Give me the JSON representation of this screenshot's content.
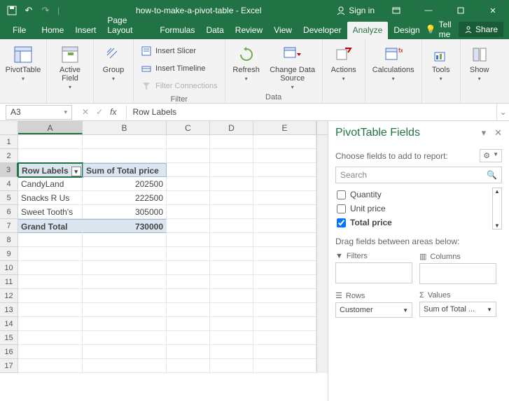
{
  "titlebar": {
    "title": "how-to-make-a-pivot-table - Excel",
    "signin": "Sign in"
  },
  "tabs": [
    "File",
    "Home",
    "Insert",
    "Page Layout",
    "Formulas",
    "Data",
    "Review",
    "View",
    "Developer",
    "Analyze",
    "Design"
  ],
  "active_tab": "Analyze",
  "tellme": "Tell me",
  "share": "Share",
  "ribbon": {
    "pivot": "PivotTable",
    "activefield": "Active\nField",
    "group": "Group",
    "slicer": "Insert Slicer",
    "timeline": "Insert Timeline",
    "filterconn": "Filter Connections",
    "filter_lbl": "Filter",
    "refresh": "Refresh",
    "chgsrc": "Change Data\nSource",
    "data_lbl": "Data",
    "actions": "Actions",
    "calc": "Calculations",
    "tools": "Tools",
    "show": "Show"
  },
  "namebox": "A3",
  "formula": "Row Labels",
  "columns": {
    "A": 92,
    "B": 120,
    "C": 62,
    "D": 62,
    "E": 62
  },
  "chart_data": {
    "type": "table",
    "title": "PivotTable",
    "columns": [
      "Row Labels",
      "Sum of Total price"
    ],
    "rows": [
      {
        "label": "CandyLand",
        "value": 202500
      },
      {
        "label": "Snacks R Us",
        "value": 222500
      },
      {
        "label": "Sweet Tooth's",
        "value": 305000
      }
    ],
    "grand_total": {
      "label": "Grand Total",
      "value": 730000
    }
  },
  "row_numbers": [
    1,
    2,
    3,
    4,
    5,
    6,
    7,
    8,
    9,
    10,
    11,
    12,
    13,
    14,
    15,
    16,
    17
  ],
  "pane": {
    "title": "PivotTable Fields",
    "subtitle": "Choose fields to add to report:",
    "search_ph": "Search",
    "fields": [
      {
        "name": "Quantity",
        "checked": false
      },
      {
        "name": "Unit price",
        "checked": false
      },
      {
        "name": "Total price",
        "checked": true
      }
    ],
    "dragtxt": "Drag fields between areas below:",
    "filters": "Filters",
    "cols": "Columns",
    "rows": "Rows",
    "vals": "Values",
    "rows_val": "Customer",
    "vals_val": "Sum of Total ..."
  }
}
